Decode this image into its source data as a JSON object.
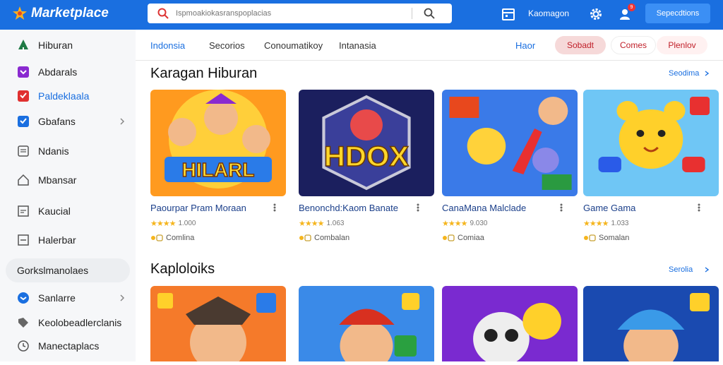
{
  "app": {
    "title": "Marketplace"
  },
  "search": {
    "placeholder": "Ispmoakiokasranspoplacias"
  },
  "toolbar": {
    "item_label": "Kaomagon",
    "notif_count": "9",
    "button_label": "Sepecdtions"
  },
  "sidebar": {
    "items": [
      {
        "label": "Hiburan",
        "icon": "tree-icon",
        "color": "#1f7a45"
      },
      {
        "label": "Abdarals",
        "icon": "chevron-square-icon",
        "color": "#8a2ad0"
      },
      {
        "label": "Paldeklaala",
        "icon": "check-square-icon",
        "color": "#e03030"
      },
      {
        "label": "Gbafans",
        "icon": "check-square-icon",
        "color": "#1a6fe0",
        "has_arrow": true
      },
      {
        "label": "Ndanis",
        "icon": "document-icon"
      },
      {
        "label": "Mbansar",
        "icon": "home-icon"
      },
      {
        "label": "Kaucial",
        "icon": "list-icon"
      },
      {
        "label": "Halerbar",
        "icon": "minus-square-icon"
      }
    ],
    "section": "Gorkslmanolaes",
    "items2": [
      {
        "label": "Sanlarre",
        "icon": "circle-chevron-icon",
        "color": "#1a6fe0",
        "has_arrow": true
      },
      {
        "label": "Keolobeadlerclanis",
        "icon": "tag-icon"
      },
      {
        "label": "Manectaplacs",
        "icon": "clock-icon"
      }
    ]
  },
  "tabs": [
    "Indonsia",
    "Secorios",
    "Conoumatikoy",
    "Intanasia"
  ],
  "tab_link": "Haor",
  "pills": [
    {
      "label": "Sobadt",
      "bg": "#f6d9d9",
      "color": "#c0202a"
    },
    {
      "label": "Comes",
      "bg": "#ffffff",
      "color": "#c0202a"
    },
    {
      "label": "Plenlov",
      "bg": "#fff1f1",
      "color": "#c0202a"
    }
  ],
  "sections": [
    {
      "title": "Karagan Hiburan",
      "link": "Seodima",
      "cards": [
        {
          "name": "Paourpar Pram Moraan",
          "rating": "1.000",
          "category": "Comlina",
          "thumb_label": "HILARL"
        },
        {
          "name": "Benonchd:Kaom Banate",
          "rating": "1.063",
          "category": "Combalan",
          "thumb_label": "HDOX"
        },
        {
          "name": "CanaMana Malclade",
          "rating": "9.030",
          "category": "Comiaa",
          "thumb_label": ""
        },
        {
          "name": "Game Gama",
          "rating": "1.033",
          "category": "Somalan",
          "thumb_label": ""
        }
      ]
    },
    {
      "title": "Kaploloiks",
      "link": "Serolia",
      "cards": [
        {
          "thumb_label": ""
        },
        {
          "thumb_label": ""
        },
        {
          "thumb_label": ""
        },
        {
          "thumb_label": ""
        }
      ]
    }
  ],
  "colors": {
    "brand": "#1a6fe0",
    "accent": "#3b8ff5"
  }
}
